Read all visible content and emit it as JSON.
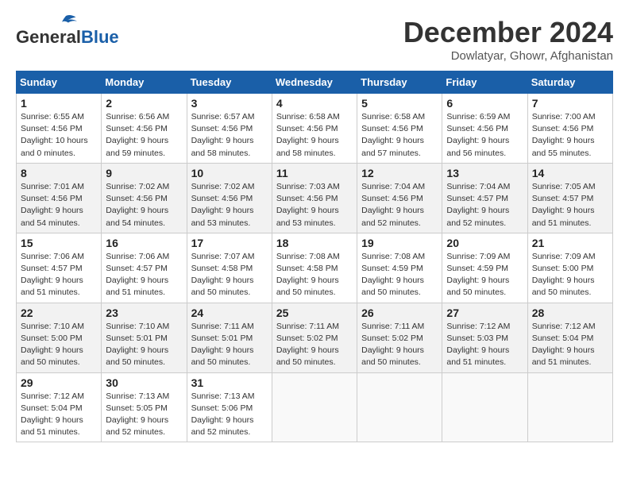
{
  "header": {
    "logo_line1": "General",
    "logo_line2": "Blue",
    "month": "December 2024",
    "location": "Dowlatyar, Ghowr, Afghanistan"
  },
  "weekdays": [
    "Sunday",
    "Monday",
    "Tuesday",
    "Wednesday",
    "Thursday",
    "Friday",
    "Saturday"
  ],
  "weeks": [
    [
      {
        "day": "1",
        "sunrise": "6:55 AM",
        "sunset": "4:56 PM",
        "daylight": "10 hours and 0 minutes."
      },
      {
        "day": "2",
        "sunrise": "6:56 AM",
        "sunset": "4:56 PM",
        "daylight": "9 hours and 59 minutes."
      },
      {
        "day": "3",
        "sunrise": "6:57 AM",
        "sunset": "4:56 PM",
        "daylight": "9 hours and 58 minutes."
      },
      {
        "day": "4",
        "sunrise": "6:58 AM",
        "sunset": "4:56 PM",
        "daylight": "9 hours and 58 minutes."
      },
      {
        "day": "5",
        "sunrise": "6:58 AM",
        "sunset": "4:56 PM",
        "daylight": "9 hours and 57 minutes."
      },
      {
        "day": "6",
        "sunrise": "6:59 AM",
        "sunset": "4:56 PM",
        "daylight": "9 hours and 56 minutes."
      },
      {
        "day": "7",
        "sunrise": "7:00 AM",
        "sunset": "4:56 PM",
        "daylight": "9 hours and 55 minutes."
      }
    ],
    [
      {
        "day": "8",
        "sunrise": "7:01 AM",
        "sunset": "4:56 PM",
        "daylight": "9 hours and 54 minutes."
      },
      {
        "day": "9",
        "sunrise": "7:02 AM",
        "sunset": "4:56 PM",
        "daylight": "9 hours and 54 minutes."
      },
      {
        "day": "10",
        "sunrise": "7:02 AM",
        "sunset": "4:56 PM",
        "daylight": "9 hours and 53 minutes."
      },
      {
        "day": "11",
        "sunrise": "7:03 AM",
        "sunset": "4:56 PM",
        "daylight": "9 hours and 53 minutes."
      },
      {
        "day": "12",
        "sunrise": "7:04 AM",
        "sunset": "4:56 PM",
        "daylight": "9 hours and 52 minutes."
      },
      {
        "day": "13",
        "sunrise": "7:04 AM",
        "sunset": "4:57 PM",
        "daylight": "9 hours and 52 minutes."
      },
      {
        "day": "14",
        "sunrise": "7:05 AM",
        "sunset": "4:57 PM",
        "daylight": "9 hours and 51 minutes."
      }
    ],
    [
      {
        "day": "15",
        "sunrise": "7:06 AM",
        "sunset": "4:57 PM",
        "daylight": "9 hours and 51 minutes."
      },
      {
        "day": "16",
        "sunrise": "7:06 AM",
        "sunset": "4:57 PM",
        "daylight": "9 hours and 51 minutes."
      },
      {
        "day": "17",
        "sunrise": "7:07 AM",
        "sunset": "4:58 PM",
        "daylight": "9 hours and 50 minutes."
      },
      {
        "day": "18",
        "sunrise": "7:08 AM",
        "sunset": "4:58 PM",
        "daylight": "9 hours and 50 minutes."
      },
      {
        "day": "19",
        "sunrise": "7:08 AM",
        "sunset": "4:59 PM",
        "daylight": "9 hours and 50 minutes."
      },
      {
        "day": "20",
        "sunrise": "7:09 AM",
        "sunset": "4:59 PM",
        "daylight": "9 hours and 50 minutes."
      },
      {
        "day": "21",
        "sunrise": "7:09 AM",
        "sunset": "5:00 PM",
        "daylight": "9 hours and 50 minutes."
      }
    ],
    [
      {
        "day": "22",
        "sunrise": "7:10 AM",
        "sunset": "5:00 PM",
        "daylight": "9 hours and 50 minutes."
      },
      {
        "day": "23",
        "sunrise": "7:10 AM",
        "sunset": "5:01 PM",
        "daylight": "9 hours and 50 minutes."
      },
      {
        "day": "24",
        "sunrise": "7:11 AM",
        "sunset": "5:01 PM",
        "daylight": "9 hours and 50 minutes."
      },
      {
        "day": "25",
        "sunrise": "7:11 AM",
        "sunset": "5:02 PM",
        "daylight": "9 hours and 50 minutes."
      },
      {
        "day": "26",
        "sunrise": "7:11 AM",
        "sunset": "5:02 PM",
        "daylight": "9 hours and 50 minutes."
      },
      {
        "day": "27",
        "sunrise": "7:12 AM",
        "sunset": "5:03 PM",
        "daylight": "9 hours and 51 minutes."
      },
      {
        "day": "28",
        "sunrise": "7:12 AM",
        "sunset": "5:04 PM",
        "daylight": "9 hours and 51 minutes."
      }
    ],
    [
      {
        "day": "29",
        "sunrise": "7:12 AM",
        "sunset": "5:04 PM",
        "daylight": "9 hours and 51 minutes."
      },
      {
        "day": "30",
        "sunrise": "7:13 AM",
        "sunset": "5:05 PM",
        "daylight": "9 hours and 52 minutes."
      },
      {
        "day": "31",
        "sunrise": "7:13 AM",
        "sunset": "5:06 PM",
        "daylight": "9 hours and 52 minutes."
      },
      null,
      null,
      null,
      null
    ]
  ]
}
